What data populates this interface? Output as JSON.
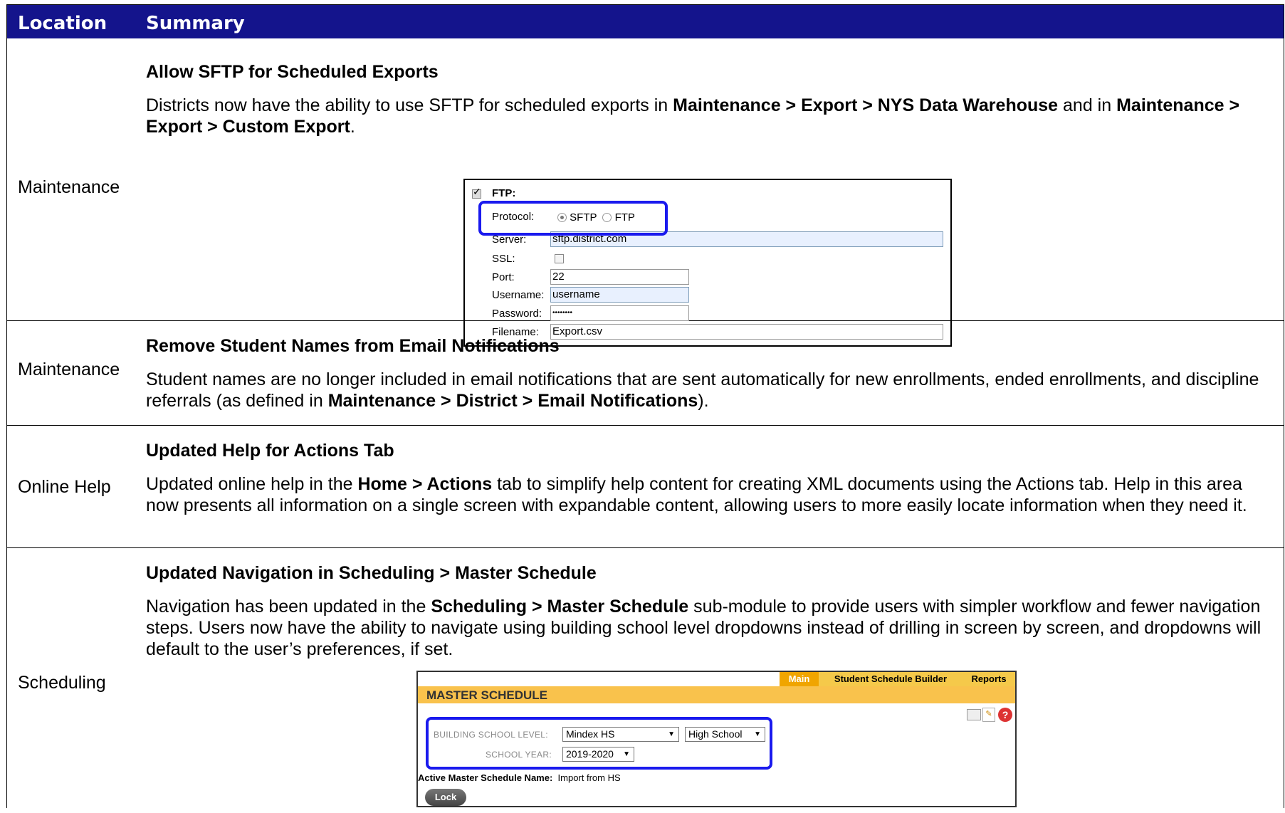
{
  "header": {
    "location": "Location",
    "summary": "Summary"
  },
  "rows": [
    {
      "location": "Maintenance",
      "title": "Allow SFTP for Scheduled Exports",
      "p1": "Districts now have the ability to use SFTP for scheduled exports in ",
      "b1": "Maintenance > Export > NYS Data Warehouse",
      "p2": " and in ",
      "b2": "Maintenance > Export > Custom Export",
      "p3": "."
    },
    {
      "location": "Maintenance",
      "title": "Remove Student Names from Email Notifications",
      "p1": "Student names are no longer included in email notifications that are sent automatically for new enrollments, ended enrollments, and discipline referrals (as defined in ",
      "b1": "Maintenance > District > Email Notifications",
      "p2": ")."
    },
    {
      "location": "Online Help",
      "title": "Updated Help for Actions Tab",
      "p1": "Updated online help in the ",
      "b1": "Home > Actions",
      "p2": " tab to simplify help content for creating XML documents using the Actions tab. Help in this area now presents all information on a single screen with expandable content, allowing users to more easily locate information when they need it."
    },
    {
      "location": "Scheduling",
      "title": "Updated Navigation in Scheduling > Master Schedule",
      "p1": "Navigation has been updated in the ",
      "b1": "Scheduling > Master Schedule",
      "p2": " sub-module to provide users with simpler workflow and fewer navigation steps. Users now have the ability to navigate using building school level dropdowns instead of drilling in screen by screen, and dropdowns will default to the user’s preferences, if set."
    }
  ],
  "ftp": {
    "checkbox_label": "FTP:",
    "protocol_label": "Protocol:",
    "opt_sftp": "SFTP",
    "opt_ftp": "FTP",
    "server_label": "Server:",
    "server_value": "sftp.district.com",
    "ssl_label": "SSL:",
    "port_label": "Port:",
    "port_value": "22",
    "username_label": "Username:",
    "username_value": "username",
    "password_label": "Password:",
    "password_value": "••••••••",
    "filename_label": "Filename:",
    "filename_value": "Export.csv"
  },
  "master_schedule": {
    "tab_main": "Main",
    "tab_builder": "Student Schedule Builder",
    "tab_reports": "Reports",
    "title": "MASTER SCHEDULE",
    "building_label": "BUILDING SCHOOL LEVEL:",
    "building_value": "Mindex HS",
    "level_value": "High School",
    "year_label": "SCHOOL YEAR:",
    "year_value": "2019-2020",
    "active_label": "Active Master Schedule Name:",
    "active_value": "Import from HS",
    "lock_button": "Lock",
    "colors": {
      "highlight": "#1a1aee",
      "header": "#14148c",
      "bar": "#f9c24c"
    }
  }
}
